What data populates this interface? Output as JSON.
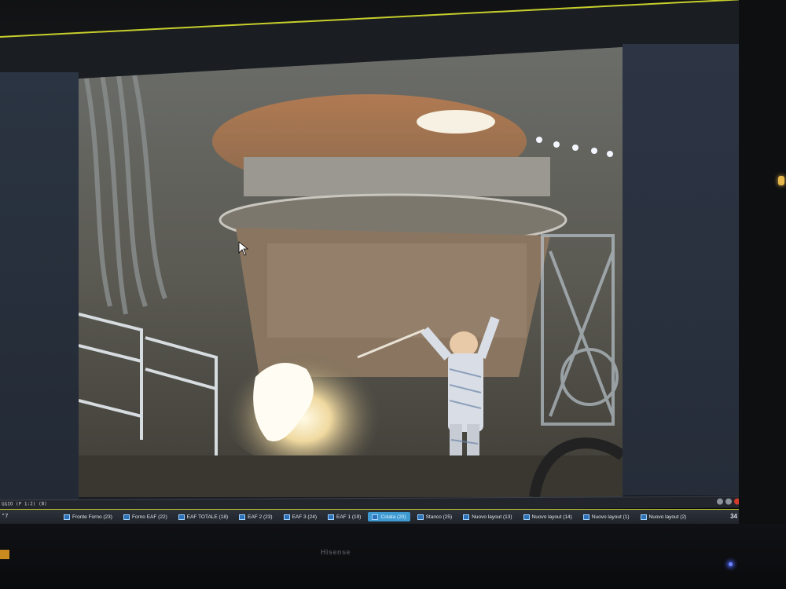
{
  "monitor": {
    "brand": "Hisense",
    "accent_color": "#c7cf2b"
  },
  "camera_feed": {
    "description_icon": "furnace-camera-view"
  },
  "status_bar": {
    "text": "GGIO (P 1:2) (B)"
  },
  "taskbar": {
    "prefix": "\"7",
    "tabs": [
      {
        "label": "Fronte Forno (23)",
        "active": false
      },
      {
        "label": "Forno EAF (22)",
        "active": false
      },
      {
        "label": "EAF TOTALE (18)",
        "active": false
      },
      {
        "label": "EAF 2 (23)",
        "active": false
      },
      {
        "label": "EAF 3 (24)",
        "active": false
      },
      {
        "label": "EAF 1 (19)",
        "active": false
      },
      {
        "label": "Colata (20)",
        "active": true
      },
      {
        "label": "Stanco (25)",
        "active": false
      },
      {
        "label": "Nuovo layout (13)",
        "active": false
      },
      {
        "label": "Nuovo layout (14)",
        "active": false
      },
      {
        "label": "Nuovo layout (1)",
        "active": false
      },
      {
        "label": "Nuovo layout (2)",
        "active": false
      }
    ],
    "page_number": "34"
  }
}
